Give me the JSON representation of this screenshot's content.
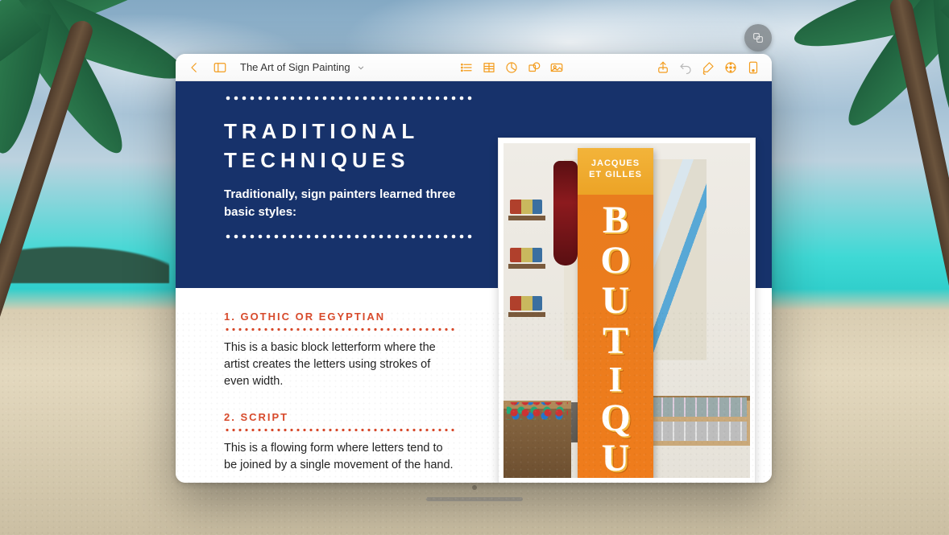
{
  "toolbar": {
    "doc_title": "The Art of Sign Painting"
  },
  "slide": {
    "heading_line1": "TRADITIONAL",
    "heading_line2": "TECHNIQUES",
    "subtitle": "Traditionally, sign painters learned three basic styles:",
    "items": [
      {
        "title": "1.  GOTHIC OR EGYPTIAN",
        "body": "This is a basic block letterform where the artist creates the letters using strokes of even width."
      },
      {
        "title": "2.  SCRIPT",
        "body": "This is a flowing form where letters tend to be joined by a single movement of the hand."
      }
    ]
  },
  "sign": {
    "cap_line1": "JACQUES",
    "cap_line2": "ET GILLES",
    "letters": [
      "B",
      "O",
      "U",
      "T",
      "I",
      "Q",
      "U"
    ]
  },
  "colors": {
    "brand_blue": "#17326b",
    "accent_red": "#d84a2b",
    "toolbar_orange": "#f39c1d",
    "sign_orange": "#ef7c1c",
    "sign_yellow": "#f3b43a"
  }
}
